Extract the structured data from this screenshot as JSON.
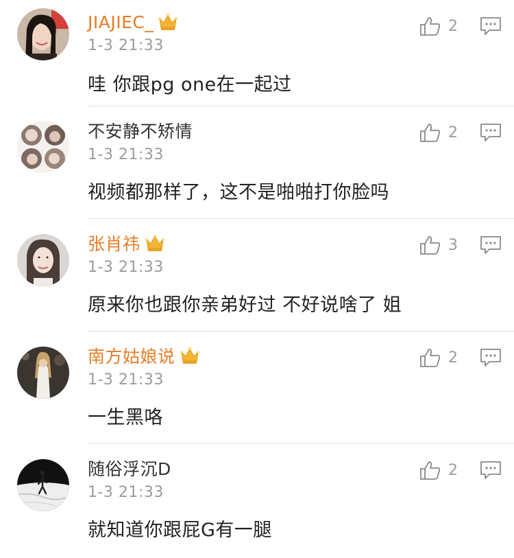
{
  "comments": [
    {
      "username": "JIAJIEC_",
      "vip": true,
      "timestamp": "1-3 21:33",
      "text": "哇 你跟pg one在一起过",
      "likes": "2"
    },
    {
      "username": "不安静不矫情",
      "vip": false,
      "timestamp": "1-3 21:33",
      "text": "视频都那样了，这不是啪啪打你脸吗",
      "likes": "2"
    },
    {
      "username": "张肖祎",
      "vip": true,
      "timestamp": "1-3 21:33",
      "text": "原来你也跟你亲弟好过 不好说啥了 姐",
      "likes": "3"
    },
    {
      "username": "南方姑娘说",
      "vip": true,
      "timestamp": "1-3 21:33",
      "text": "一生黑咯",
      "likes": "2"
    },
    {
      "username": "随俗浮沉D",
      "vip": false,
      "timestamp": "1-3 21:33",
      "text": "就知道你跟屁G有一腿",
      "likes": "2"
    }
  ],
  "colors": {
    "vip_username": "#e87c25",
    "normal_username": "#333333",
    "meta_gray": "#9b9b9b",
    "crown_gold": "#f2b533",
    "divider": "#e3e3e3"
  },
  "icons": {
    "like": "thumbs-up-outline-icon",
    "reply": "speech-bubble-outline-icon",
    "vip_badge": "crown-icon"
  }
}
